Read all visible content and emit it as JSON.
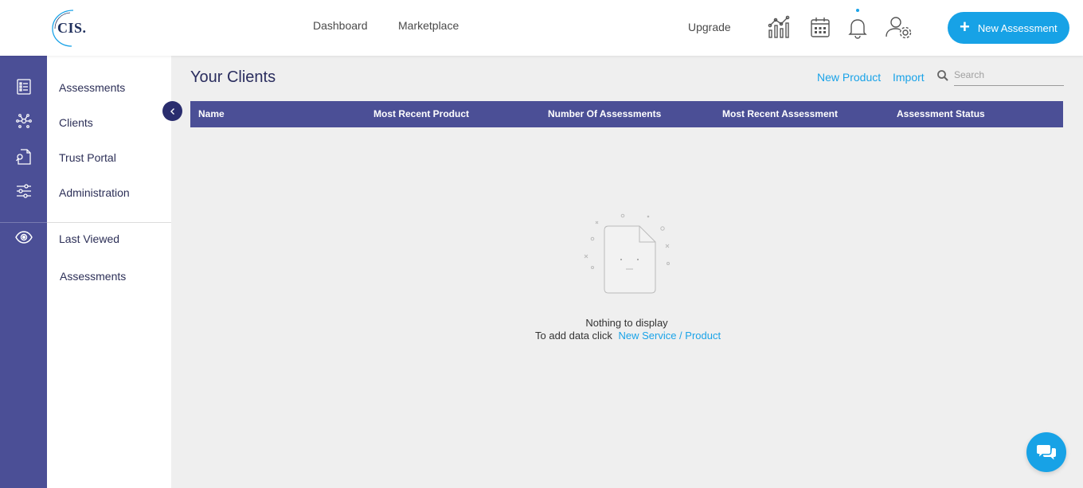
{
  "app": {
    "logo_text": "CIS."
  },
  "topnav": {
    "dashboard": "Dashboard",
    "marketplace": "Marketplace",
    "upgrade": "Upgrade",
    "new_assessment": "New Assessment",
    "icons": [
      "analytics-icon",
      "calendar-icon",
      "bell-icon",
      "user-settings-icon"
    ]
  },
  "rail": {
    "icons": [
      "assessments-icon",
      "clients-network-icon",
      "trust-portal-icon",
      "administration-sliders-icon",
      "eye-icon"
    ]
  },
  "sidebar": {
    "items": [
      {
        "label": "Assessments"
      },
      {
        "label": "Clients"
      },
      {
        "label": "Trust Portal"
      },
      {
        "label": "Administration"
      }
    ],
    "last_viewed": {
      "title": "Last Viewed",
      "items": [
        {
          "label": "Assessments"
        }
      ]
    }
  },
  "main": {
    "title": "Your Clients",
    "actions": {
      "new_product": "New Product",
      "import": "Import"
    },
    "search": {
      "placeholder": "Search",
      "value": ""
    },
    "table": {
      "columns": [
        "Name",
        "Most Recent Product",
        "Number Of Assessments",
        "Most Recent Assessment",
        "Assessment Status"
      ],
      "rows": []
    },
    "empty_state": {
      "title": "Nothing to display",
      "prompt": "To add data click",
      "link": "New Service / Product"
    }
  },
  "colors": {
    "primary": "#4b4f96",
    "accent": "#17a2e6",
    "collapse": "#2a2d6e",
    "background": "#efefef"
  }
}
